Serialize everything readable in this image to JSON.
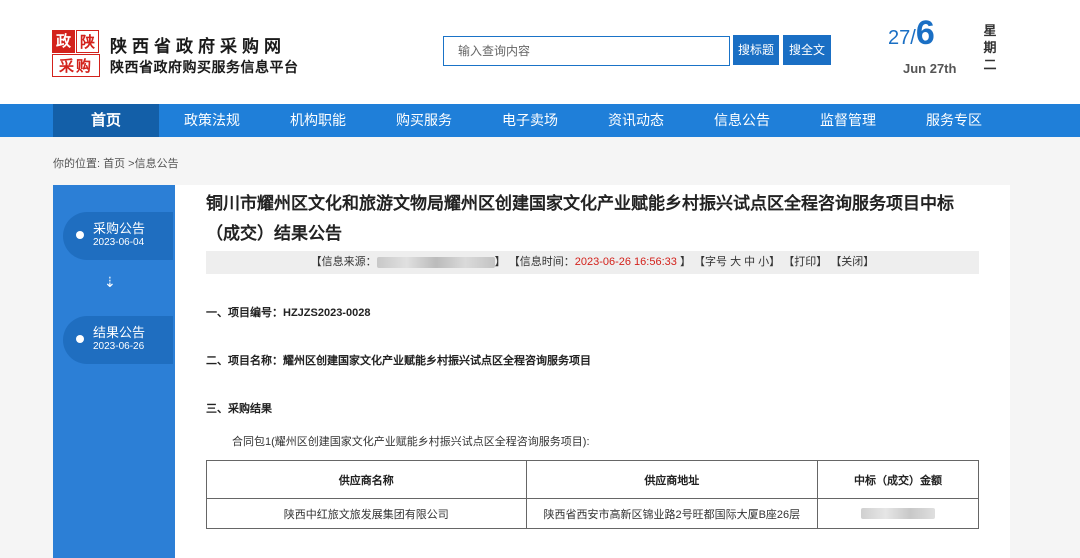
{
  "header": {
    "logo": [
      "政",
      "陕",
      "采购"
    ],
    "site_title": "陕西省政府采购网",
    "site_subtitle": "陕西省政府购买服务信息平台",
    "search_placeholder": "输入查询内容",
    "search_title_label": "搜标题",
    "search_full_label": "搜全文",
    "date_day_prefix": "27/",
    "date_month": "6",
    "date_en": "Jun 27th",
    "weekday": [
      "星",
      "期",
      "二"
    ]
  },
  "nav": {
    "items": [
      "首页",
      "政策法规",
      "机构职能",
      "购买服务",
      "电子卖场",
      "资讯动态",
      "信息公告",
      "监督管理",
      "服务专区"
    ]
  },
  "breadcrumb": {
    "label": "你的位置:",
    "home": "首页",
    "sep": " >",
    "current": "信息公告"
  },
  "sidebar": {
    "timeline": [
      {
        "title": "采购公告",
        "date": "2023-06-04"
      },
      {
        "title": "结果公告",
        "date": "2023-06-26"
      }
    ],
    "arrow": "⇣"
  },
  "article": {
    "title": "铜川市耀州区文化和旅游文物局耀州区创建国家文化产业赋能乡村振兴试点区全程咨询服务项目中标（成交）结果公告",
    "meta_source_label": "【信息来源：",
    "meta_source_end": "】",
    "meta_time_label": "【信息时间：",
    "meta_time": "2023-06-26 16:56:33",
    "meta_time_end": " 】",
    "meta_font": "【字号 大 中 小】",
    "meta_print": "【打印】",
    "meta_close": "【关闭】",
    "sec1": "一、项目编号：HZJZS2023-0028",
    "sec2": "二、项目名称：耀州区创建国家文化产业赋能乡村振兴试点区全程咨询服务项目",
    "sec3": "三、采购结果",
    "package": "合同包1(耀州区创建国家文化产业赋能乡村振兴试点区全程咨询服务项目):",
    "table": {
      "headers": [
        "供应商名称",
        "供应商地址",
        "中标（成交）金额"
      ],
      "rows": [
        [
          "陕西中红旅文旅发展集团有限公司",
          "陕西省西安市高新区锦业路2号旺都国际大厦B座26层",
          ""
        ]
      ]
    }
  }
}
